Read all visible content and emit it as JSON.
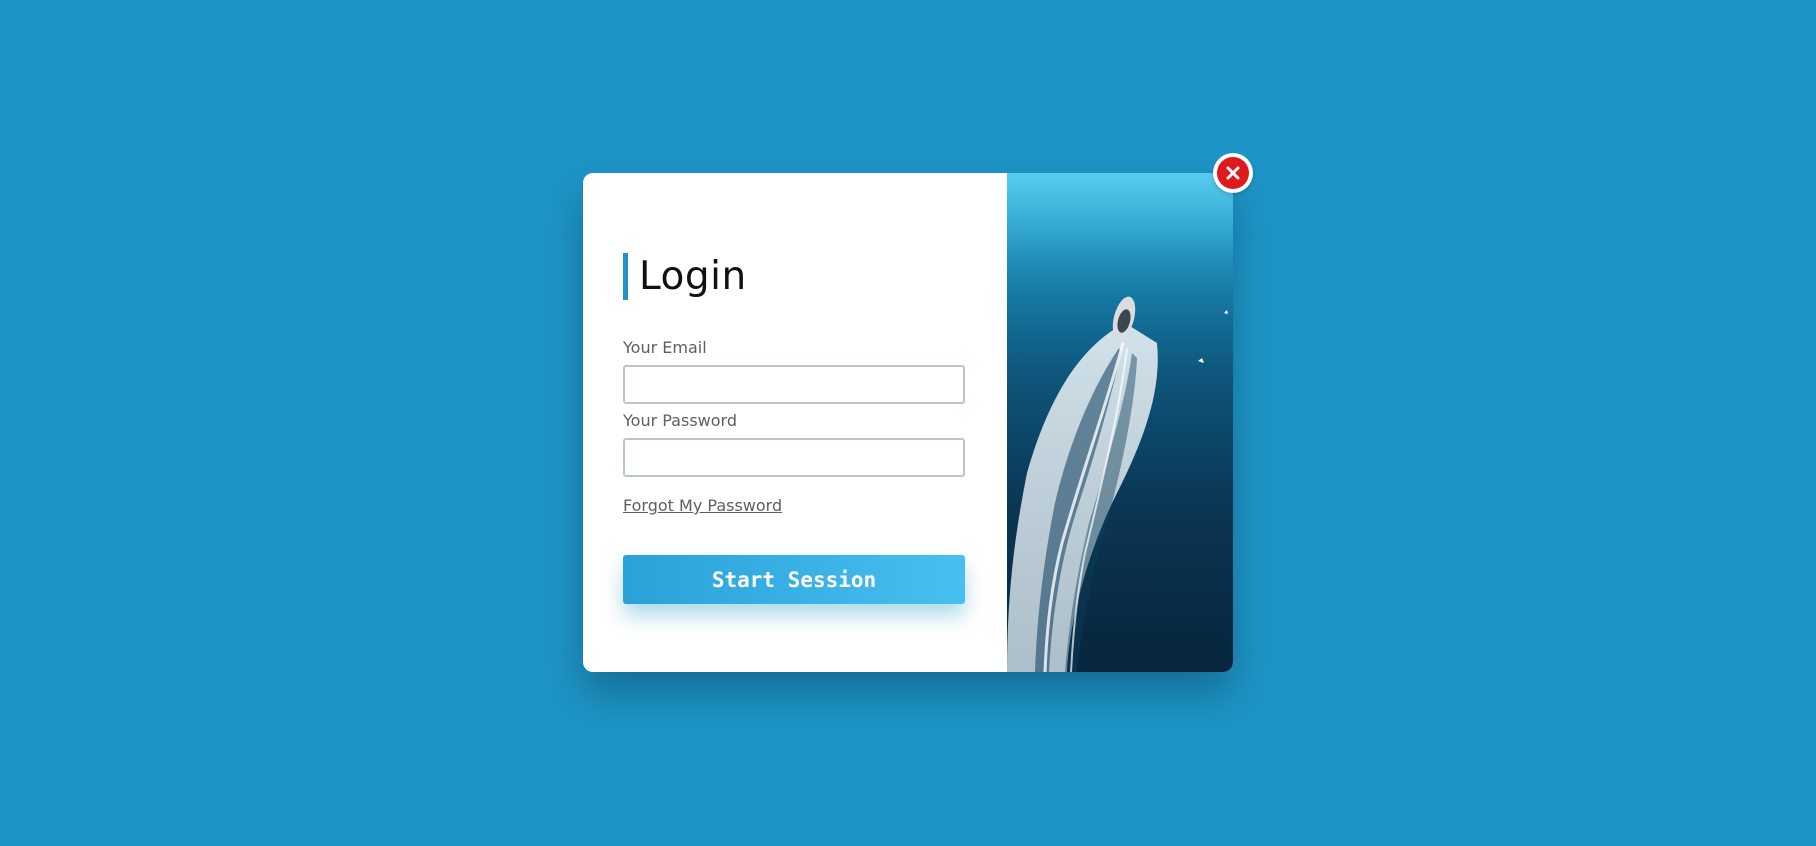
{
  "login": {
    "title": "Login",
    "email_label": "Your Email",
    "email_value": "",
    "email_placeholder": "",
    "password_label": "Your Password",
    "password_value": "",
    "password_placeholder": "",
    "forgot_link": "Forgot My Password",
    "submit_label": "Start Session"
  },
  "icons": {
    "close": "close-icon"
  },
  "colors": {
    "background": "#1e95c6",
    "accent": "#1e95c6",
    "button_gradient_start": "#2aa2d8",
    "button_gradient_end": "#47bff0",
    "close": "#e0191f"
  }
}
